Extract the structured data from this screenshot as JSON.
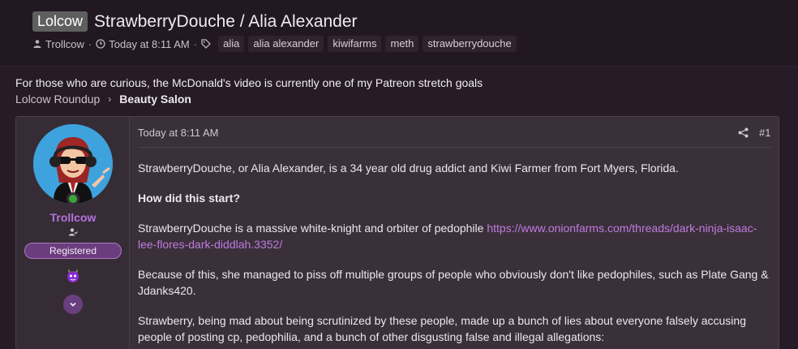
{
  "thread": {
    "prefix": "Lolcow",
    "title": "StrawberryDouche / Alia Alexander",
    "author": "Trollcow",
    "date": "Today at 8:11 AM",
    "tags": [
      "alia",
      "alia alexander",
      "kiwifarms",
      "meth",
      "strawberrydouche"
    ]
  },
  "notice": "For those who are curious, the McDonald's video is currently one of my Patreon stretch goals",
  "breadcrumb": {
    "items": [
      "Lolcow Roundup",
      "Beauty Salon"
    ]
  },
  "post": {
    "user": {
      "name": "Trollcow",
      "badge": "Registered",
      "online": true
    },
    "date": "Today at 8:11 AM",
    "number": "#1",
    "paragraphs": {
      "p1": "StrawberryDouche, or Alia Alexander, is a 34 year old drug addict and Kiwi Farmer from Fort Myers, Florida.",
      "h1": "How did this start?",
      "p2_text": "StrawberryDouche is a massive white-knight and orbiter of pedophile ",
      "p2_link": "https://www.onionfarms.com/threads/dark-ninja-isaac-lee-flores-dark-diddlah.3352/",
      "p3": "Because of this, she managed to piss off multiple groups of people who obviously don't like pedophiles, such as Plate Gang & Jdanks420.",
      "p4": "Strawberry, being mad about being scrutinized by these people, made up a bunch of lies about everyone falsely accusing people of posting cp, pedophilia, and a bunch of other disgusting false and illegal allegations:"
    }
  },
  "icons": {
    "author": "user-icon",
    "date": "clock-icon",
    "tags": "tag-icon",
    "share": "share-icon",
    "usertitle": "user-check-icon",
    "trophy": "purple-demon-icon",
    "expand": "chevron-down-icon"
  },
  "colors": {
    "background": "#261b26",
    "post_bg": "#3a303a",
    "username": "#b572dc",
    "link": "#c07be0",
    "badge_bg": "#6c3d7e",
    "prefix_bg": "#5f5f5f",
    "online": "#3aa63a"
  }
}
